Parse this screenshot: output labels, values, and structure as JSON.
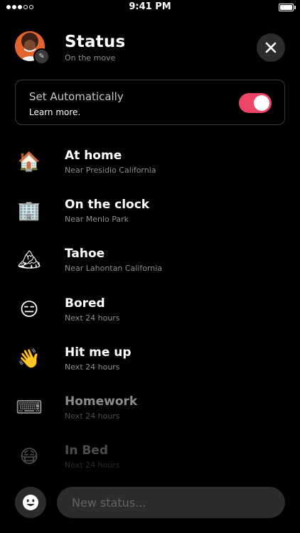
{
  "status_bar": {
    "time": "9:41 PM",
    "signal_bars_filled": 3,
    "signal_bars_total": 5,
    "battery_level": 1.0
  },
  "header": {
    "title": "Status",
    "subtitle": "On the move",
    "avatar_icon": "user-avatar",
    "edit_icon": "pencil-icon",
    "close_icon": "close-icon"
  },
  "auto": {
    "title": "Set Automatically",
    "link": "Learn more.",
    "enabled": true,
    "accent_color": "#ee4466"
  },
  "statuses": [
    {
      "emoji": "🏠",
      "label": "At home",
      "sub": "Near Presidio California",
      "opacity": 1.0
    },
    {
      "emoji": "🏢",
      "label": "On the clock",
      "sub": "Near Menlo Park",
      "opacity": 1.0
    },
    {
      "emoji": "🏔",
      "label": "Tahoe",
      "sub": "Near Lahontan California",
      "opacity": 1.0
    },
    {
      "emoji": "😑",
      "label": "Bored",
      "sub": "Next 24 hours",
      "opacity": 1.0
    },
    {
      "emoji": "👋",
      "label": "Hit me up",
      "sub": "Next 24 hours",
      "opacity": 1.0
    },
    {
      "emoji": "⌨",
      "label": "Homework",
      "sub": "Next 24 hours",
      "opacity": 0.55
    },
    {
      "emoji": "😷",
      "label": "In Bed",
      "sub": "Next 24 hours",
      "opacity": 0.3
    }
  ],
  "composer": {
    "placeholder": "New status...",
    "value": "",
    "emoji_button_icon": "smiley-icon"
  }
}
